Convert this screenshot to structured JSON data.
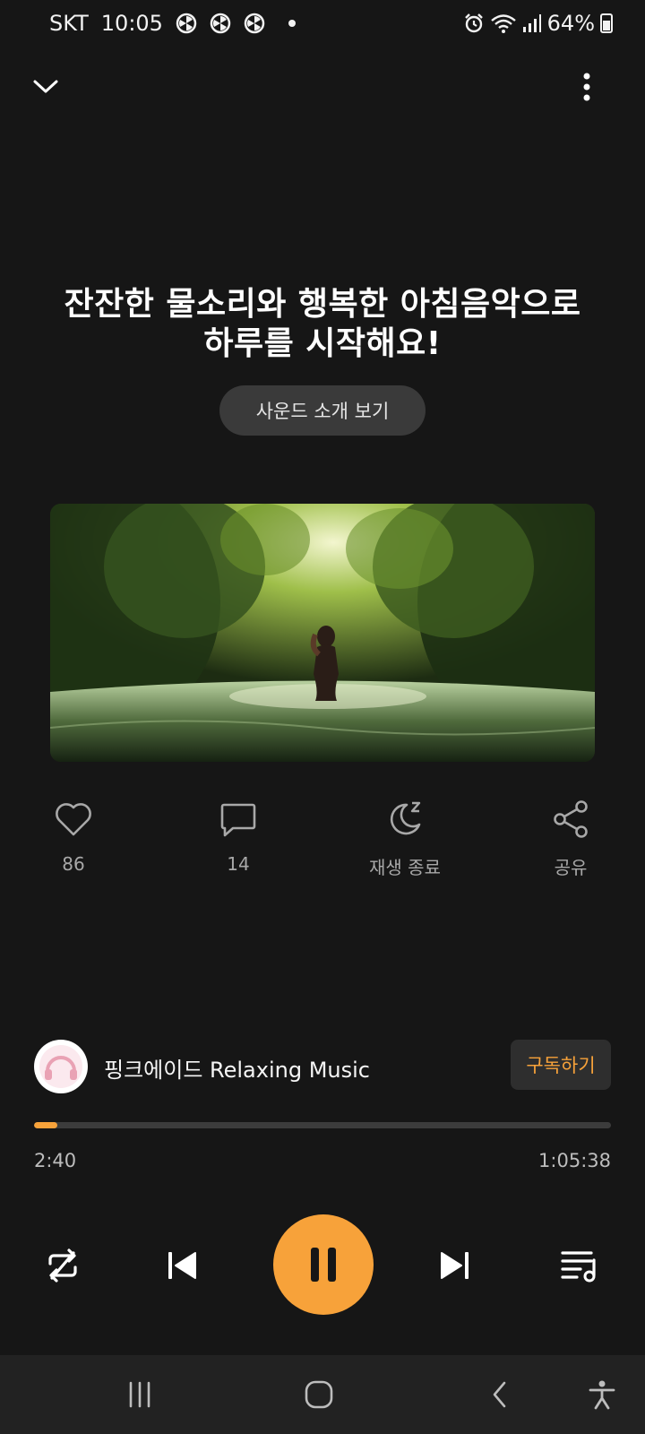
{
  "status_bar": {
    "carrier": "SKT",
    "time": "10:05",
    "battery": "64%"
  },
  "header": {
    "collapse_icon": "chevron-down-icon",
    "more_icon": "more-vertical-icon"
  },
  "content": {
    "title_line1": "잔잔한 물소리와 행복한 아침음악으로",
    "title_line2": "하루를 시작해요!",
    "intro_button": "사운드 소개 보기"
  },
  "actions": {
    "like_count": "86",
    "comment_count": "14",
    "sleep_timer_label": "재생 종료",
    "share_label": "공유"
  },
  "channel": {
    "name": "핑크에이드 Relaxing Music",
    "subscribe_label": "구독하기"
  },
  "player": {
    "elapsed": "2:40",
    "total": "1:05:38",
    "progress_fraction": 0.04
  },
  "colors": {
    "accent": "#f7a23a",
    "background": "#161616"
  }
}
